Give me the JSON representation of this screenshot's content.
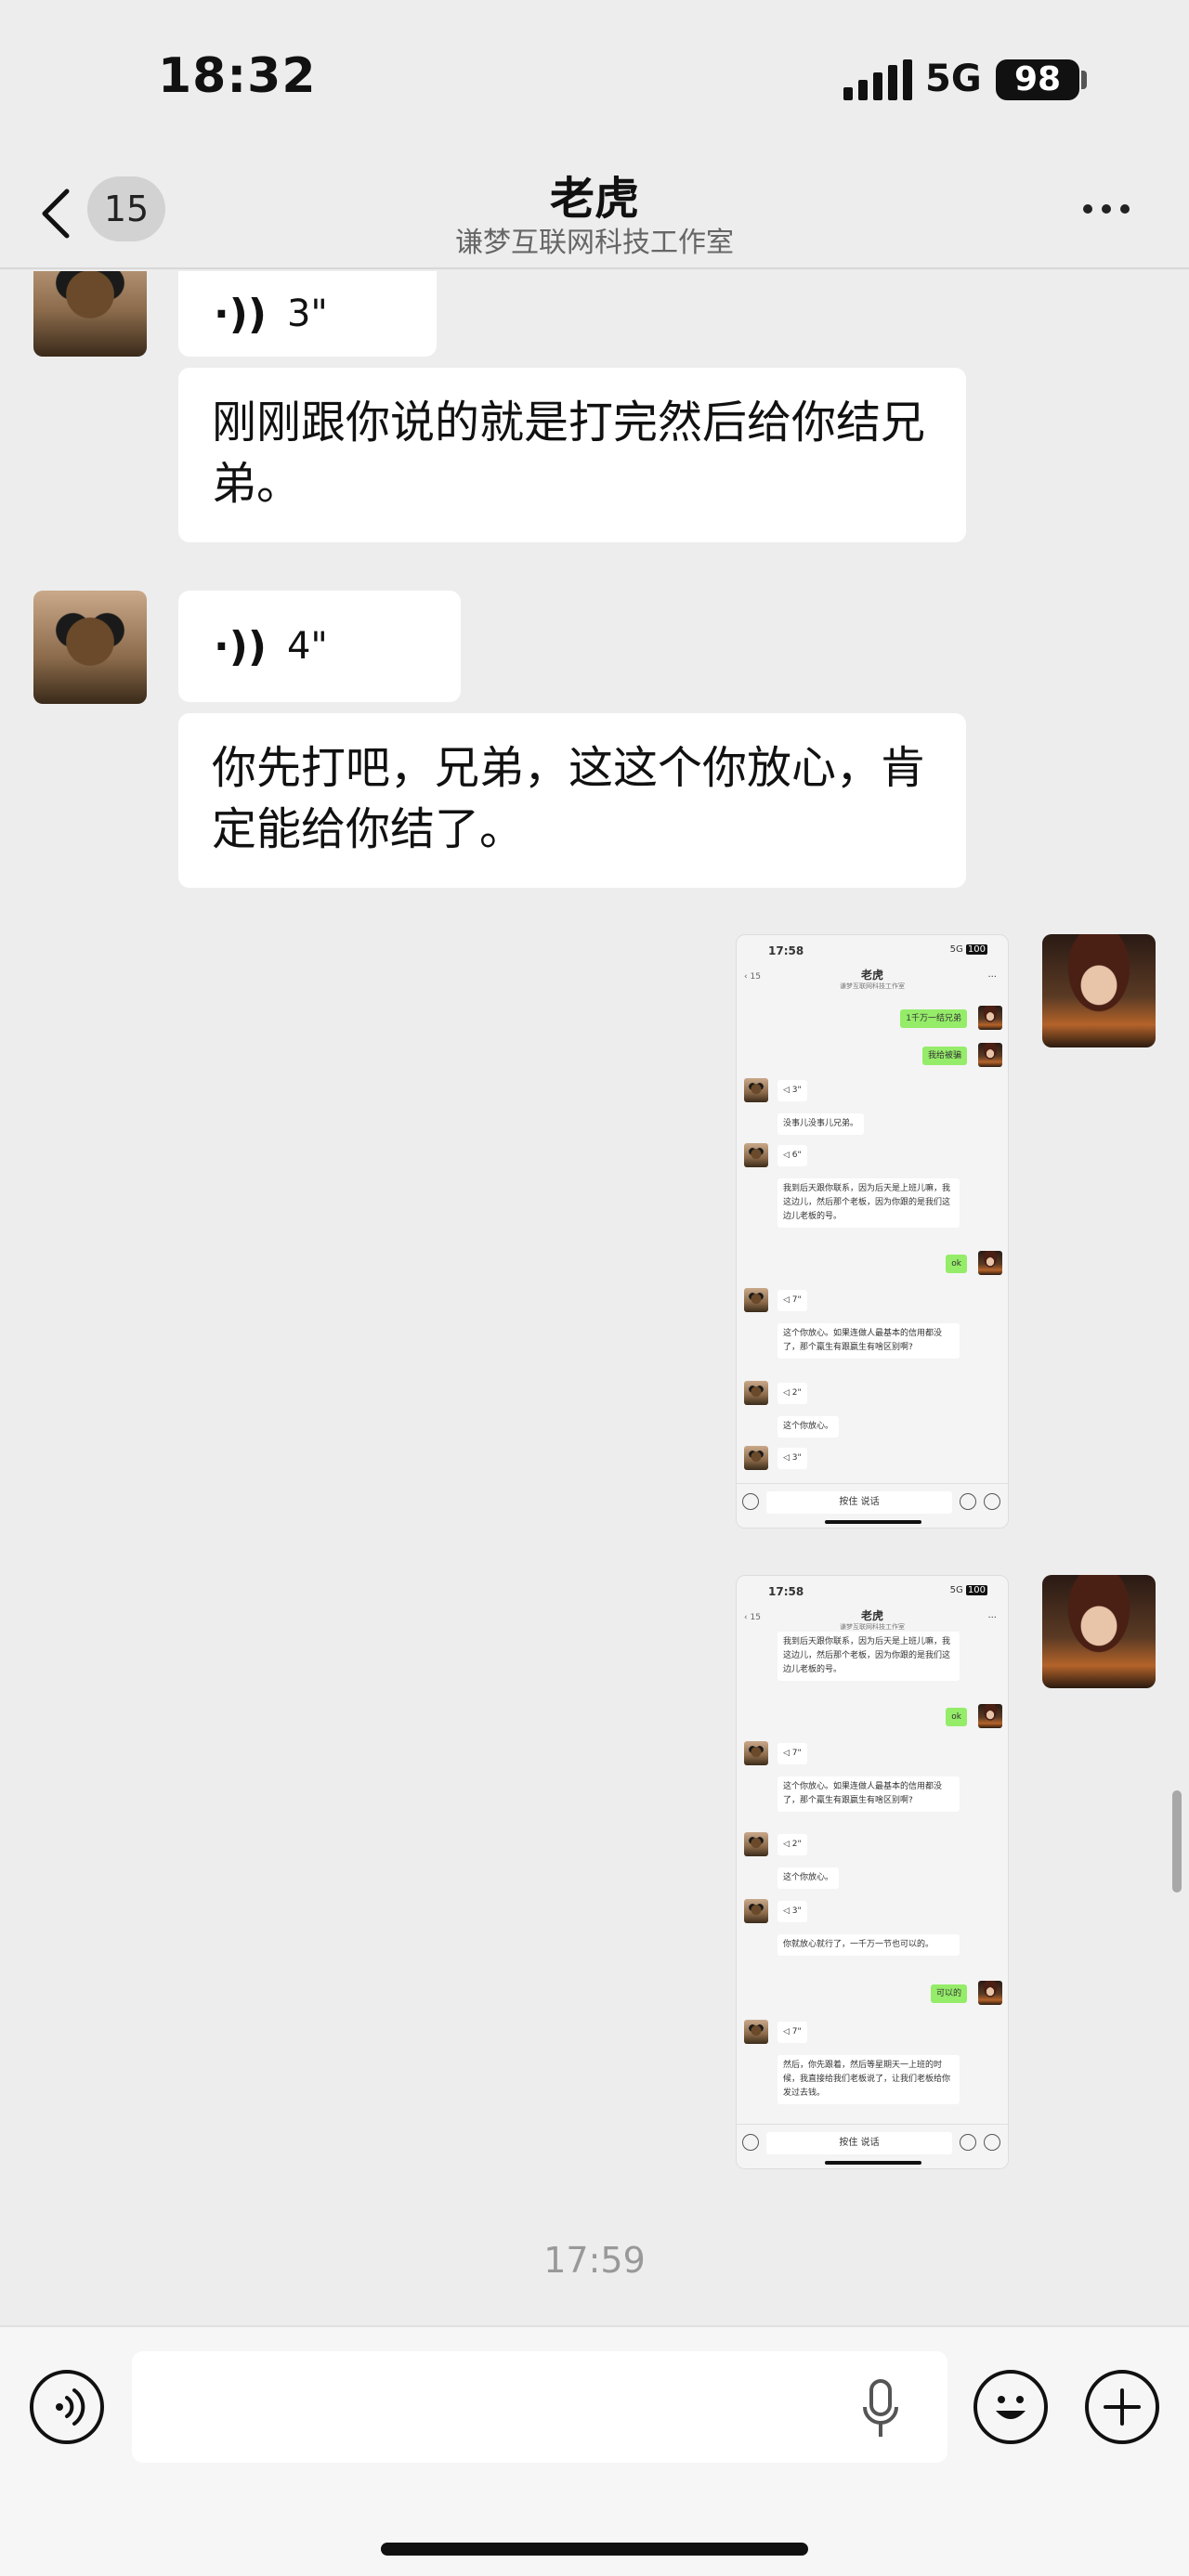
{
  "status_bar": {
    "time": "18:32",
    "network": "5G",
    "battery": "98"
  },
  "nav": {
    "back_badge": "15",
    "title": "老虎",
    "subtitle": "谦梦互联网科技工作室"
  },
  "messages": [
    {
      "type": "voice",
      "duration": "3\""
    },
    {
      "type": "text",
      "text": "刚刚跟你说的就是打完然后给你结兄弟。"
    },
    {
      "type": "voice",
      "duration": "4\""
    },
    {
      "type": "text",
      "text": "你先打吧，兄弟，这这个你放心，肯定能给你结了。"
    }
  ],
  "screenshot1": {
    "time": "17:58",
    "network": "5G",
    "battery": "100",
    "badge": "15",
    "title": "老虎",
    "subtitle": "谦梦互联网科技工作室",
    "msgs": [
      "1千万一结兄弟",
      "我给被骗",
      "3\"",
      "没事儿没事儿兄弟。",
      "6\"",
      "我到后天跟你联系，因为后天是上班儿嘛，我这边儿，然后那个老板，因为你跟的是我们这边儿老板的号。",
      "ok",
      "7\"",
      "这个你放心。如果连做人最基本的信用都没了，那个羸生有跟嬴生有啥区别啊?",
      "2\"",
      "这个你放心。",
      "3\""
    ],
    "input_label": "按住 说话"
  },
  "screenshot2": {
    "time": "17:58",
    "network": "5G",
    "battery": "100",
    "badge": "15",
    "title": "老虎",
    "subtitle": "谦梦互联网科技工作室",
    "msgs": [
      "我到后天跟你联系，因为后天是上班儿嘛，我这边儿，然后那个老板，因为你跟的是我们这边儿老板的号。",
      "ok",
      "7\"",
      "这个你放心。如果连做人最基本的信用都没了，那个羸生有跟嬴生有啥区别啊?",
      "2\"",
      "这个你放心。",
      "3\"",
      "你就放心就行了，一千万一节也可以的。",
      "可以的",
      "7\"",
      "然后，你先跟着，然后等星期天一上班的时候，我直接给我们老板说了，让我们老板给你发过去钱。"
    ],
    "input_label": "按住 说话"
  },
  "timestamp": "17:59"
}
